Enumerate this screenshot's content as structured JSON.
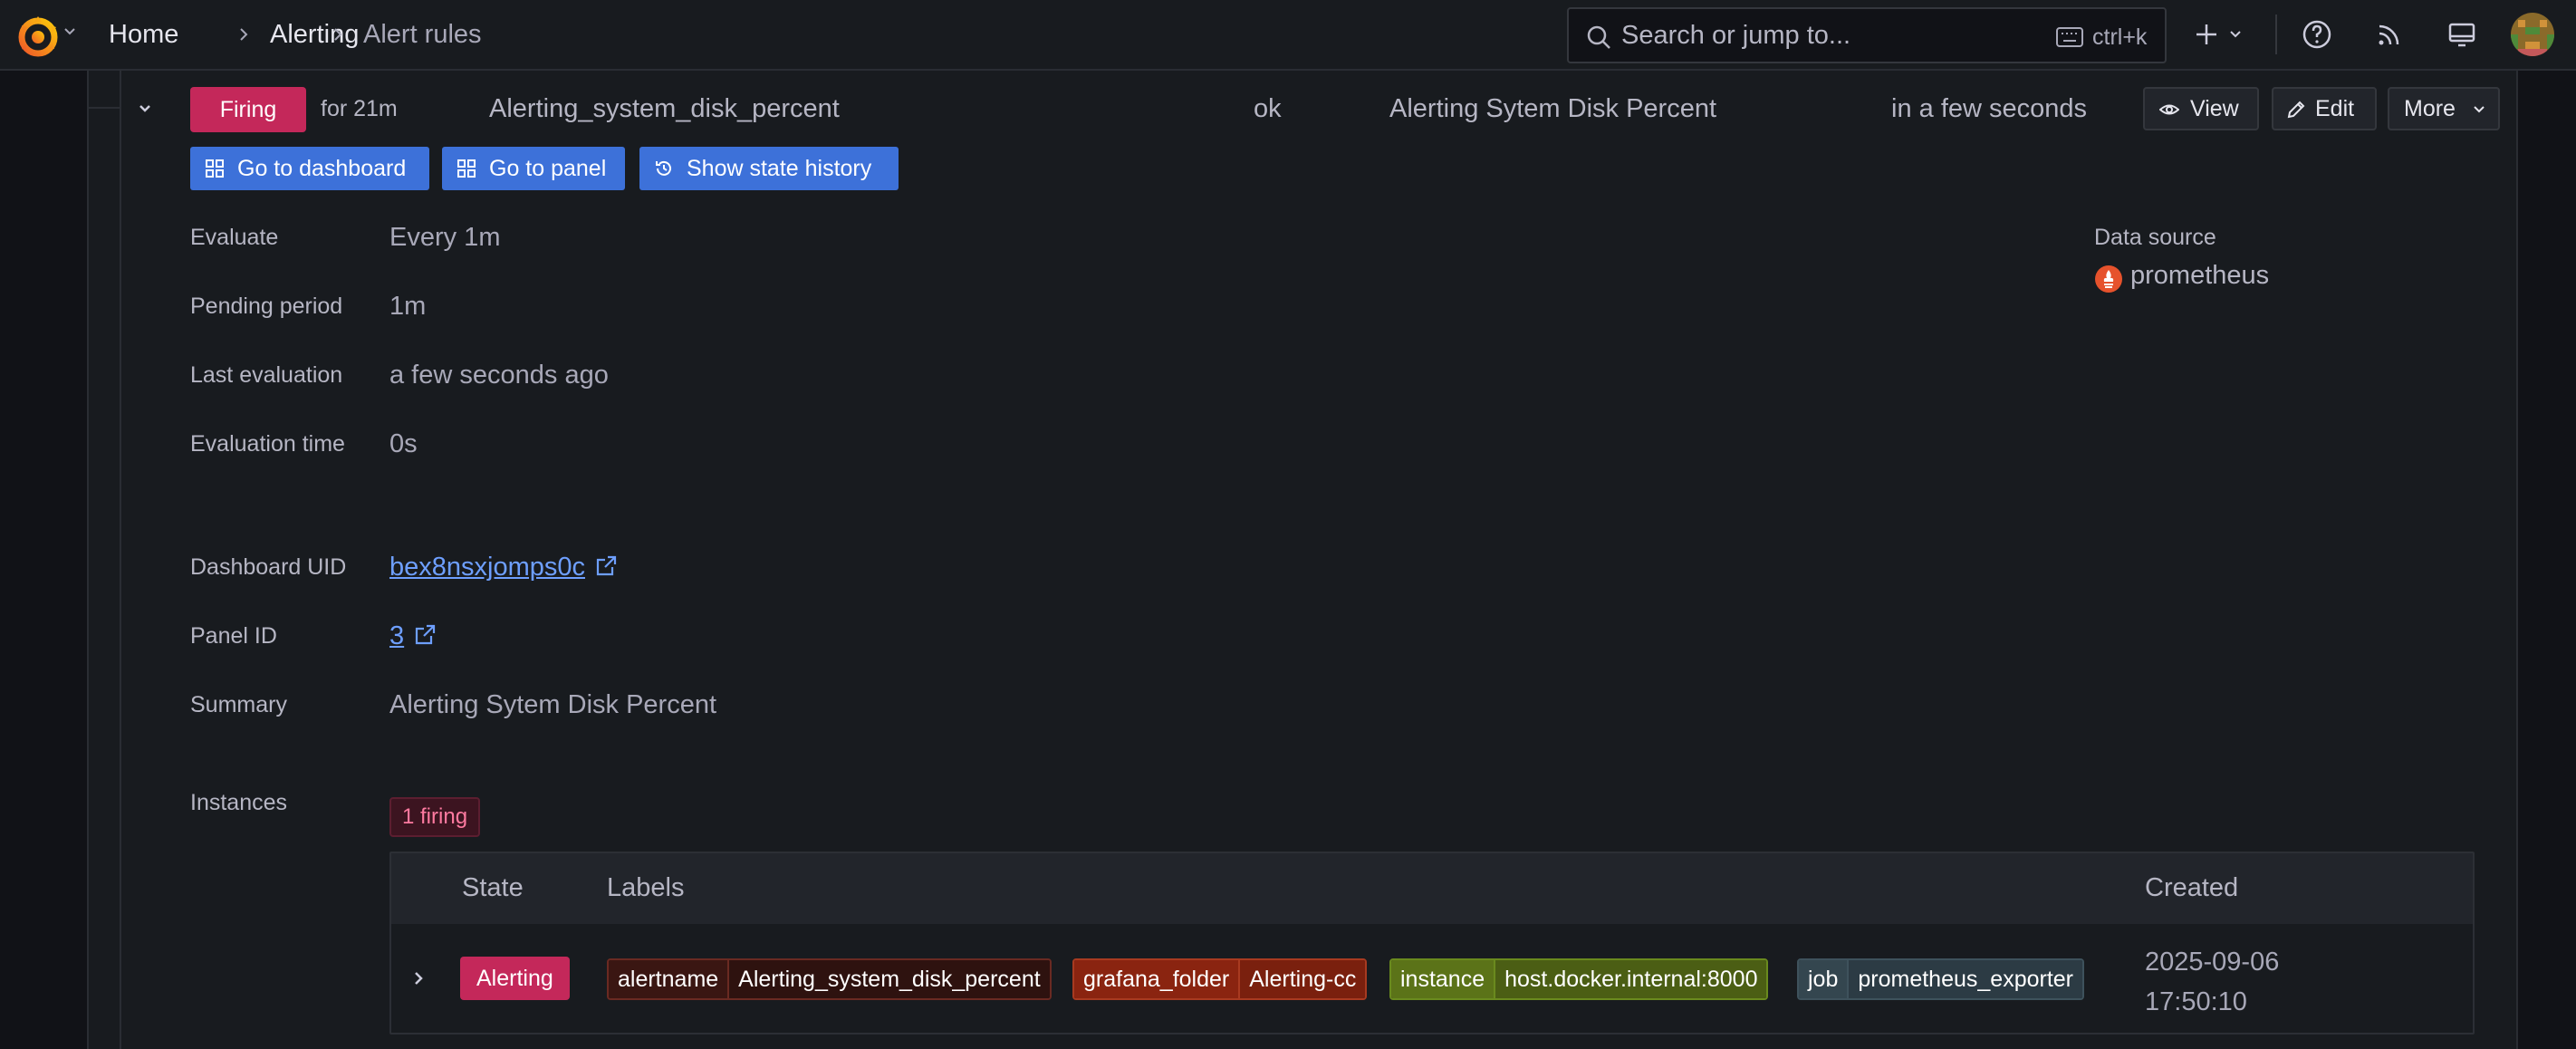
{
  "nav": {
    "breadcrumbs": [
      "Home",
      "Alerting",
      "Alert rules"
    ],
    "search_placeholder": "Search or jump to...",
    "search_shortcut": "ctrl+k"
  },
  "rule": {
    "state": "Firing",
    "state_duration": "for 21m",
    "name": "Alerting_system_disk_percent",
    "health": "ok",
    "summary": "Alerting Sytem Disk Percent",
    "next_evaluation": "in a few seconds",
    "actions": {
      "view": "View",
      "edit": "Edit",
      "more": "More",
      "go_to_dashboard": "Go to dashboard",
      "go_to_panel": "Go to panel",
      "show_state_history": "Show state history"
    }
  },
  "details": {
    "evaluate_label": "Evaluate",
    "evaluate_value": "Every 1m",
    "pending_label": "Pending period",
    "pending_value": "1m",
    "last_eval_label": "Last evaluation",
    "last_eval_value": "a few seconds ago",
    "eval_time_label": "Evaluation time",
    "eval_time_value": "0s",
    "dashboard_uid_label": "Dashboard UID",
    "dashboard_uid_value": "bex8nsxjomps0c",
    "panel_id_label": "Panel ID",
    "panel_id_value": "3",
    "summary_label": "Summary",
    "summary_value": "Alerting Sytem Disk Percent",
    "datasource_label": "Data source",
    "datasource_value": "prometheus"
  },
  "instances": {
    "label": "Instances",
    "count_badge": "1 firing",
    "columns": [
      "State",
      "Labels",
      "Created"
    ],
    "rows": [
      {
        "state": "Alerting",
        "labels": [
          {
            "key": "alertname",
            "value": "Alerting_system_disk_percent"
          },
          {
            "key": "grafana_folder",
            "value": "Alerting-cc"
          },
          {
            "key": "instance",
            "value": "host.docker.internal:8000"
          },
          {
            "key": "job",
            "value": "prometheus_exporter"
          }
        ],
        "created_date": "2025-09-06",
        "created_time": "17:50:10"
      }
    ]
  },
  "colors": {
    "firing": "#c4285a",
    "link": "#6e9fff",
    "primary_button": "#3d71d9",
    "chip_alertname": "#4a1a14",
    "chip_folder": "#8a2410",
    "chip_instance": "#4b5e14",
    "chip_job": "#2c3b44"
  }
}
